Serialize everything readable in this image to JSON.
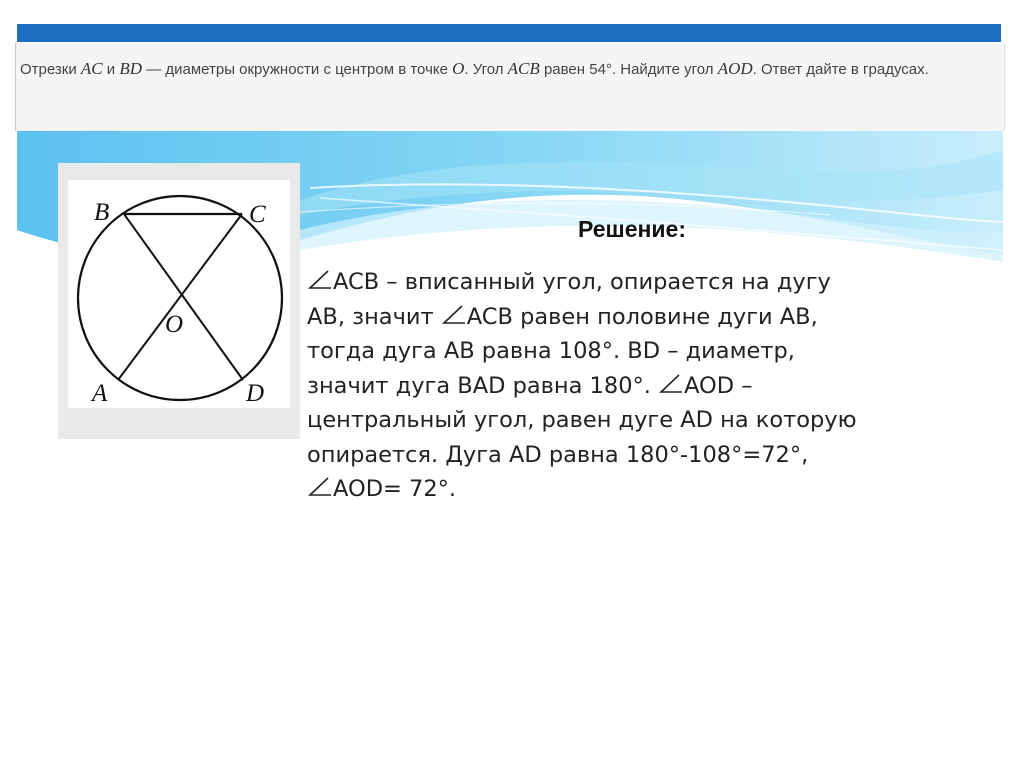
{
  "task": {
    "parts": [
      {
        "t": "Отрезки ",
        "m": false
      },
      {
        "t": "AC",
        "m": true
      },
      {
        "t": " и ",
        "m": false
      },
      {
        "t": "BD",
        "m": true
      },
      {
        "t": " — диаметры окружности с центром в точке ",
        "m": false
      },
      {
        "t": "O",
        "m": true
      },
      {
        "t": ". Угол ",
        "m": false
      },
      {
        "t": "ACB",
        "m": true
      },
      {
        "t": " равен 54°. Найдите угол ",
        "m": false
      },
      {
        "t": "AOD",
        "m": true
      },
      {
        "t": ". Ответ дайте в градусах.",
        "m": false
      }
    ]
  },
  "figure": {
    "labels": {
      "B": "B",
      "C": "C",
      "O": "O",
      "A": "A",
      "D": "D"
    }
  },
  "solution": {
    "heading": "Решение:",
    "lines": [
      [
        {
          "angle": true
        },
        {
          "t": "ACB – вписанный угол, опирается на дугу"
        }
      ],
      [
        {
          "t": "AB, значит "
        },
        {
          "angle": true
        },
        {
          "t": "ACB равен половине дуги AB,"
        }
      ],
      [
        {
          "t": "тогда дуга AB равна 108°. BD – диаметр,"
        }
      ],
      [
        {
          "t": "значит дуга BAD равна 180°. "
        },
        {
          "angle": true
        },
        {
          "t": "AOD –"
        }
      ],
      [
        {
          "t": "центральный угол, равен дуге AD на которую"
        }
      ],
      [
        {
          "t": "опирается. Дуга AD равна 180°-108°=72°,"
        }
      ],
      [
        {
          "angle": true
        },
        {
          "t": "AOD= 72°."
        }
      ]
    ]
  },
  "colors": {
    "top_bar": "#1c6fc1",
    "wave_light": "#7fd3f3",
    "wave_mid": "#4fb8ea"
  }
}
